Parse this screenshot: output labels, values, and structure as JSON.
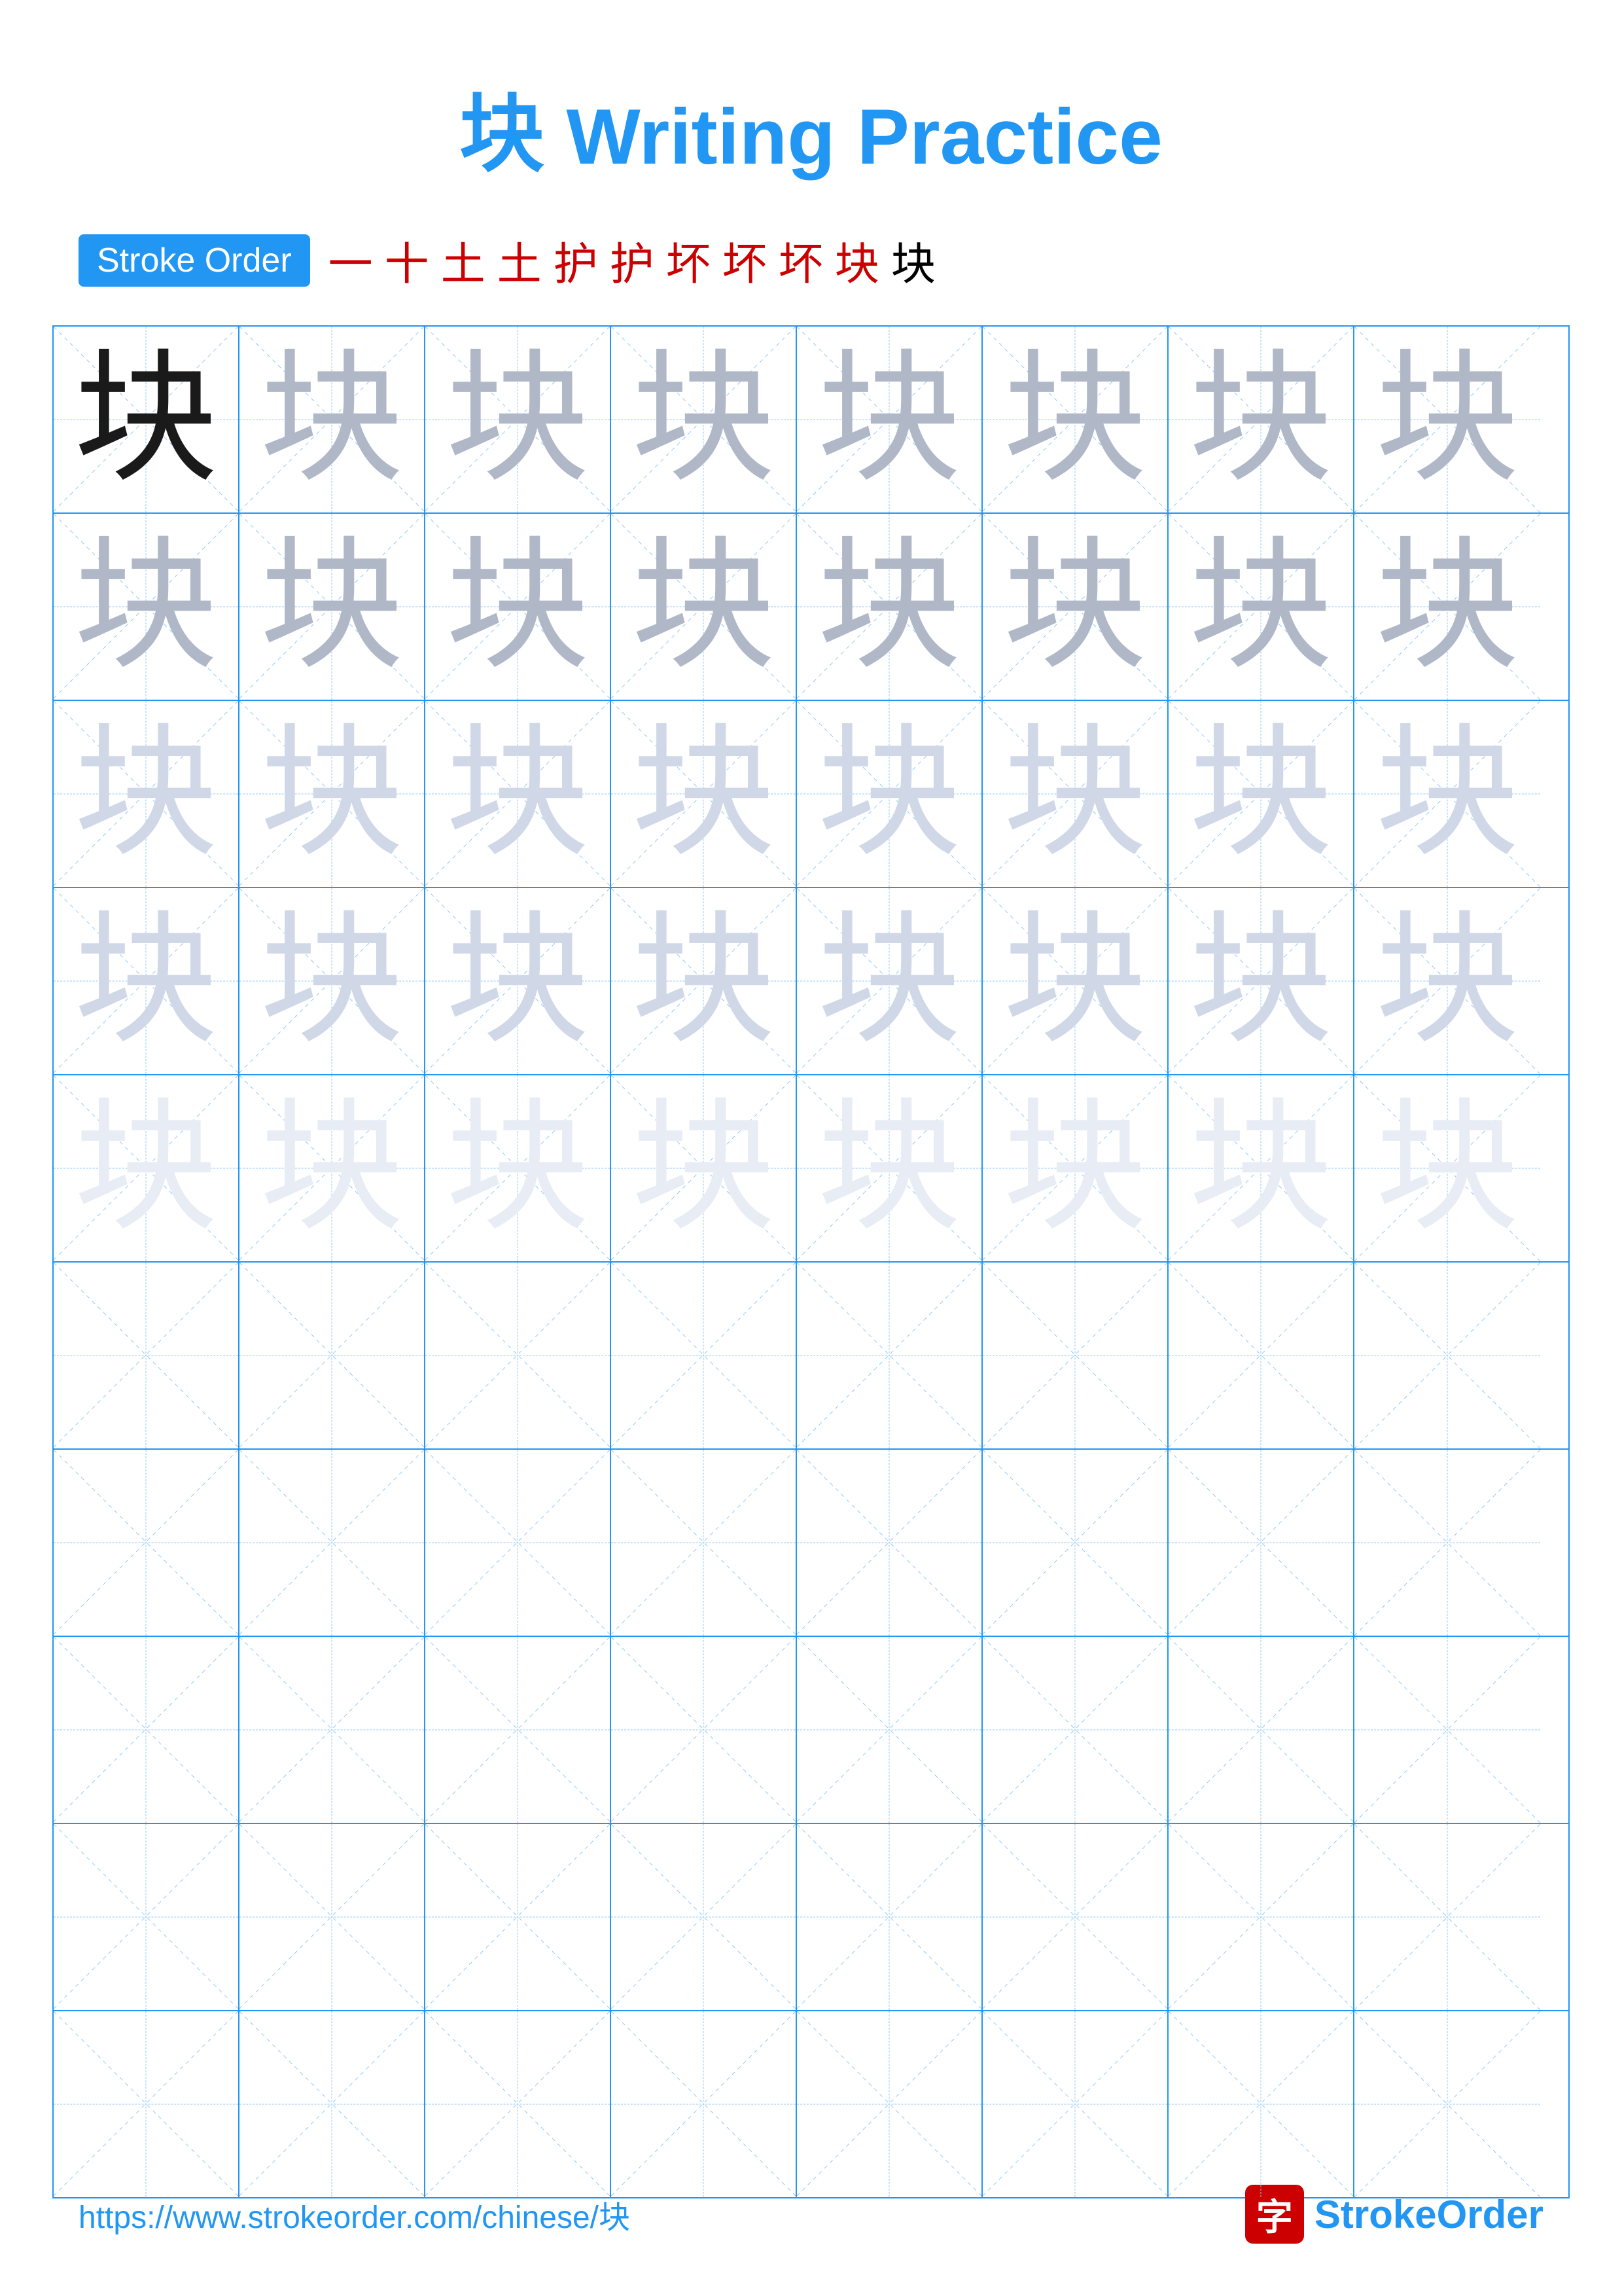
{
  "title": {
    "char": "块",
    "text": " Writing Practice"
  },
  "stroke_order": {
    "badge": "Stroke Order",
    "strokes": [
      "一",
      "十",
      "土",
      "土",
      "护",
      "护",
      "坏",
      "坏",
      "坏",
      "块",
      "块"
    ]
  },
  "grid": {
    "rows": 10,
    "cols": 8,
    "char": "块",
    "filled_rows": [
      [
        "dark",
        "medium",
        "medium",
        "medium",
        "medium",
        "medium",
        "medium",
        "medium"
      ],
      [
        "medium",
        "medium",
        "medium",
        "medium",
        "medium",
        "medium",
        "medium",
        "medium"
      ],
      [
        "light",
        "light",
        "light",
        "light",
        "light",
        "light",
        "light",
        "light"
      ],
      [
        "light",
        "light",
        "light",
        "light",
        "light",
        "light",
        "light",
        "light"
      ],
      [
        "very-light",
        "very-light",
        "very-light",
        "very-light",
        "very-light",
        "very-light",
        "very-light",
        "very-light"
      ],
      [
        "empty",
        "empty",
        "empty",
        "empty",
        "empty",
        "empty",
        "empty",
        "empty"
      ],
      [
        "empty",
        "empty",
        "empty",
        "empty",
        "empty",
        "empty",
        "empty",
        "empty"
      ],
      [
        "empty",
        "empty",
        "empty",
        "empty",
        "empty",
        "empty",
        "empty",
        "empty"
      ],
      [
        "empty",
        "empty",
        "empty",
        "empty",
        "empty",
        "empty",
        "empty",
        "empty"
      ],
      [
        "empty",
        "empty",
        "empty",
        "empty",
        "empty",
        "empty",
        "empty",
        "empty"
      ]
    ]
  },
  "footer": {
    "url": "https://www.strokeorder.com/chinese/块",
    "brand_char": "字",
    "brand_name_part1": "Stroke",
    "brand_name_part2": "Order"
  }
}
